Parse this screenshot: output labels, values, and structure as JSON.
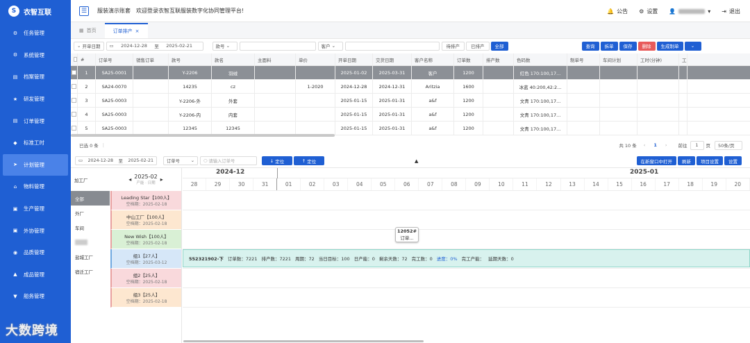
{
  "brand": {
    "name": "衣智互联",
    "mark": "S"
  },
  "sidebar": {
    "items": [
      {
        "label": "任务管理",
        "icon": "⚙"
      },
      {
        "label": "系统管理",
        "icon": "⚙"
      },
      {
        "label": "档案管理",
        "icon": "▤"
      },
      {
        "label": "研发管理",
        "icon": "★"
      },
      {
        "label": "订单管理",
        "icon": "▤"
      },
      {
        "label": "标准工时",
        "icon": "◆"
      },
      {
        "label": "计划管理",
        "icon": "➤"
      },
      {
        "label": "物料管理",
        "icon": "⌂"
      },
      {
        "label": "生产管理",
        "icon": "▣"
      },
      {
        "label": "外协管理",
        "icon": "▣"
      },
      {
        "label": "品质管理",
        "icon": "◉"
      },
      {
        "label": "成品管理",
        "icon": "▲"
      },
      {
        "label": "船务管理",
        "icon": "▼"
      }
    ]
  },
  "header": {
    "title": "服装演示账套",
    "welcome": "欢迎登录衣智互联服装数字化协同管理平台!",
    "notice": "公告",
    "settings": "设置",
    "logout": "退出"
  },
  "tabs": [
    {
      "label": "首页"
    },
    {
      "label": "订单排产",
      "close": "×"
    }
  ],
  "filter": {
    "date_type": "开单日期",
    "date_from": "2024-12-28",
    "date_sep": "至",
    "date_to": "2025-02-21",
    "field_select": "款号",
    "customer_select": "客户",
    "pending": "待排产",
    "scheduled": "已排产",
    "all": "全部",
    "query": "查询",
    "split": "拆单",
    "save": "保存",
    "delete": "删除",
    "generate": "生成制单"
  },
  "table": {
    "columns": [
      "#",
      "订单号",
      "销售订单",
      "款号",
      "款名",
      "主面料",
      "单价",
      "开单日期",
      "交货日期",
      "客户名称",
      "订单数",
      "排产数",
      "色码数",
      "制单号",
      "车间计划",
      "工时(分钟)",
      "工时(小"
    ],
    "rows": [
      [
        "1",
        "SA25-0001",
        "",
        "Y-2206",
        "羽绒",
        "",
        "",
        "2025-01-02",
        "2025-03-31",
        "客户",
        "1200",
        "",
        "红色 170:100,17...",
        "",
        "",
        "",
        ""
      ],
      [
        "2",
        "SA24-0070",
        "",
        "14235",
        "cz",
        "",
        "1-2020",
        "2024-12-28",
        "2024-12-31",
        "Aritzia",
        "1600",
        "",
        "冰蓝 40:200,42:2...",
        "",
        "",
        "",
        ""
      ],
      [
        "3",
        "SA25-0003",
        "",
        "Y-2206-外",
        "外套",
        "",
        "",
        "2025-01-15",
        "2025-01-31",
        "a&f",
        "1200",
        "",
        "文青 170:100,17...",
        "",
        "",
        "",
        ""
      ],
      [
        "4",
        "SA25-0003",
        "",
        "Y-2206-内",
        "内套",
        "",
        "",
        "2025-01-15",
        "2025-01-31",
        "a&f",
        "1200",
        "",
        "文青 170:100,17...",
        "",
        "",
        "",
        ""
      ],
      [
        "5",
        "SA25-0003",
        "",
        "12345",
        "12345",
        "",
        "",
        "2025-01-15",
        "2025-01-31",
        "a&f",
        "1200",
        "",
        "文青 170:100,17...",
        "",
        "",
        "",
        ""
      ]
    ]
  },
  "footer": {
    "selected": "已选 0 条",
    "total": "共 10 条",
    "page": "1",
    "goto": "前往",
    "goto_page": "1",
    "page_unit": "页",
    "page_size": "50条/页"
  },
  "lower": {
    "date_from": "2024-12-28",
    "date_sep": "至",
    "date_to": "2025-02-21",
    "order_select": "订单号",
    "order_placeholder": "请输入订单号",
    "locate1": "定位",
    "locate2": "定位",
    "open_new": "在新窗口中打开",
    "refresh": "刷新",
    "project_settings": "项目设置",
    "settings": "设置"
  },
  "gantt": {
    "factory_label": "加工厂",
    "factories": [
      "全部",
      "外厂",
      "车间",
      "",
      "盐城工厂",
      "宿迁工厂"
    ],
    "month": "2025-02",
    "month_sub": "产能 · 日期",
    "year_left": "2024-12",
    "year_right": "2025-01",
    "days": [
      "28",
      "29",
      "30",
      "31",
      "01",
      "02",
      "03",
      "04",
      "05",
      "06",
      "07",
      "08",
      "09",
      "10",
      "11",
      "12",
      "13",
      "14",
      "15",
      "16",
      "17",
      "18",
      "19",
      "20"
    ],
    "teams": [
      {
        "name": "Leading Star【100人】",
        "date": "空档期：2025-02-18",
        "color": "#f9d9dc"
      },
      {
        "name": "中山工厂【100人】",
        "date": "空档期：2025-02-18",
        "color": "#fde7d0"
      },
      {
        "name": "New Wish【100人】",
        "date": "空档期：2025-02-18",
        "color": "#d9f0d5"
      },
      {
        "name": "组1【27人】",
        "date": "空档期：2025-03-12",
        "color": "#d6e7f8"
      },
      {
        "name": "组2【25人】",
        "date": "空档期：2025-02-18",
        "color": "#f9d9dc"
      },
      {
        "name": "组3【25人】",
        "date": "空档期：2025-02-18",
        "color": "#fde7d0"
      }
    ],
    "card": {
      "line1": "12052#",
      "line2": "订单..."
    },
    "info": {
      "code": "552321902-下",
      "order_qty": "订单数：7221",
      "sched_qty": "排产数：7221",
      "cycle": "周期：72",
      "daily_target": "当日目标：100",
      "daily_output": "日产能：0",
      "remaining_days": "剩余天数：72",
      "done_qty": "完工数：0",
      "progress": "进度：0%",
      "done_output": "完工产能：",
      "delay_days": "延期天数：0"
    }
  },
  "watermark": "大数跨境"
}
